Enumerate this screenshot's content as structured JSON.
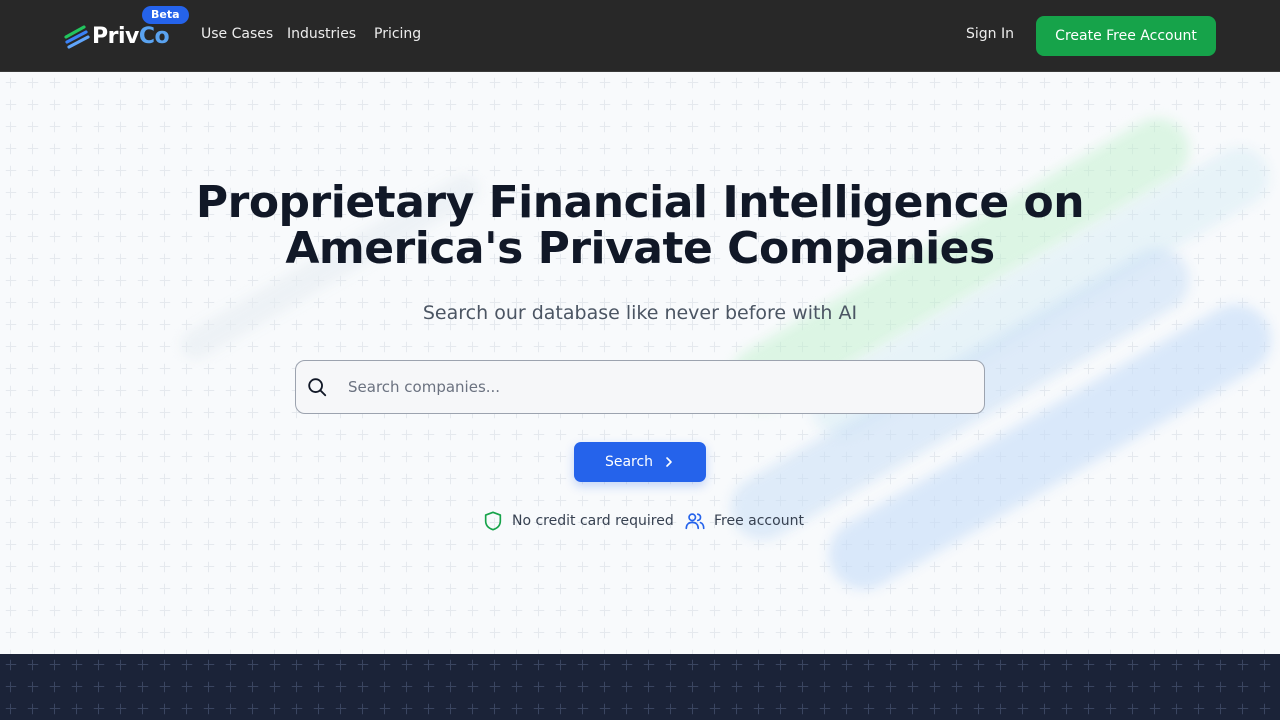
{
  "header": {
    "brand": {
      "priv": "Priv",
      "co": "Co"
    },
    "beta_badge": "Beta",
    "nav": [
      {
        "label": "Use Cases"
      },
      {
        "label": "Industries"
      },
      {
        "label": "Pricing"
      }
    ],
    "sign_in": "Sign In",
    "create_account": "Create Free Account"
  },
  "hero": {
    "headline_line1": "Proprietary Financial Intelligence on",
    "headline_line2": "America's Private Companies",
    "subheadline": "Search our database like never before with AI",
    "search": {
      "placeholder": "Search companies...",
      "value": ""
    },
    "search_button": "Search",
    "features": [
      {
        "icon": "shield-icon",
        "label": "No credit card required"
      },
      {
        "icon": "users-icon",
        "label": "Free account"
      }
    ]
  },
  "colors": {
    "topbar": "#282828",
    "accent_green": "#16a34a",
    "accent_blue": "#2563eb",
    "brand_co": "#5aa3f0",
    "band": "#1b2338"
  }
}
